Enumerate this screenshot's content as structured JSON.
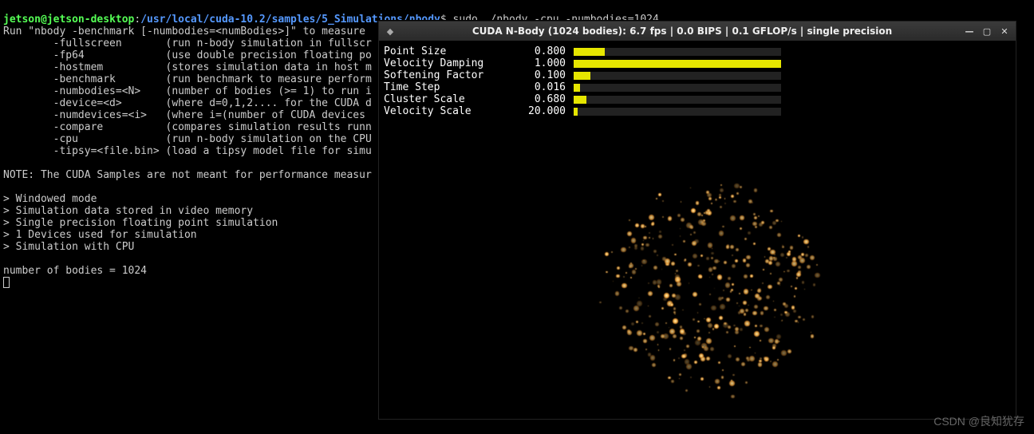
{
  "prompt": {
    "user": "jetson",
    "host": "jetson-desktop",
    "path": "/usr/local/cuda-10.2/samples/5_Simulations/nbody",
    "command": "sudo ./nbody -cpu -numbodies=1024"
  },
  "terminal_output": {
    "help_header": "Run \"nbody -benchmark [-numbodies=<numBodies>]\" to measure ",
    "opts": [
      {
        "flag": "-fullscreen",
        "desc": "(run n-body simulation in fullscr"
      },
      {
        "flag": "-fp64",
        "desc": "(use double precision floating po"
      },
      {
        "flag": "-hostmem",
        "desc": "(stores simulation data in host m"
      },
      {
        "flag": "-benchmark",
        "desc": "(run benchmark to measure perform"
      },
      {
        "flag": "-numbodies=<N>",
        "desc": "(number of bodies (>= 1) to run i"
      },
      {
        "flag": "-device=<d>",
        "desc": "(where d=0,1,2.... for the CUDA d"
      },
      {
        "flag": "-numdevices=<i>",
        "desc": "(where i=(number of CUDA devices "
      },
      {
        "flag": "-compare",
        "desc": "(compares simulation results runn"
      },
      {
        "flag": "-cpu",
        "desc": "(run n-body simulation on the CPU"
      },
      {
        "flag": "-tipsy=<file.bin>",
        "desc": "(load a tipsy model file for simu"
      }
    ],
    "note": "NOTE: The CUDA Samples are not meant for performance measur",
    "status": [
      "> Windowed mode",
      "> Simulation data stored in video memory",
      "> Single precision floating point simulation",
      "> 1 Devices used for simulation",
      "> Simulation with CPU"
    ],
    "bodies_line": "number of bodies = 1024"
  },
  "sim_window": {
    "title": "CUDA N-Body (1024 bodies): 6.7 fps | 0.0 BIPS | 0.1 GFLOP/s | single precision",
    "params": [
      {
        "label": "Point Size",
        "value": "0.800",
        "fill_pct": 15
      },
      {
        "label": "Velocity Damping",
        "value": "1.000",
        "fill_pct": 100
      },
      {
        "label": "Softening Factor",
        "value": "0.100",
        "fill_pct": 8
      },
      {
        "label": "Time Step",
        "value": "0.016",
        "fill_pct": 3
      },
      {
        "label": "Cluster Scale",
        "value": "0.680",
        "fill_pct": 6
      },
      {
        "label": "Velocity Scale",
        "value": "20.000",
        "fill_pct": 2
      }
    ]
  },
  "watermark": "CSDN @良知犹存"
}
